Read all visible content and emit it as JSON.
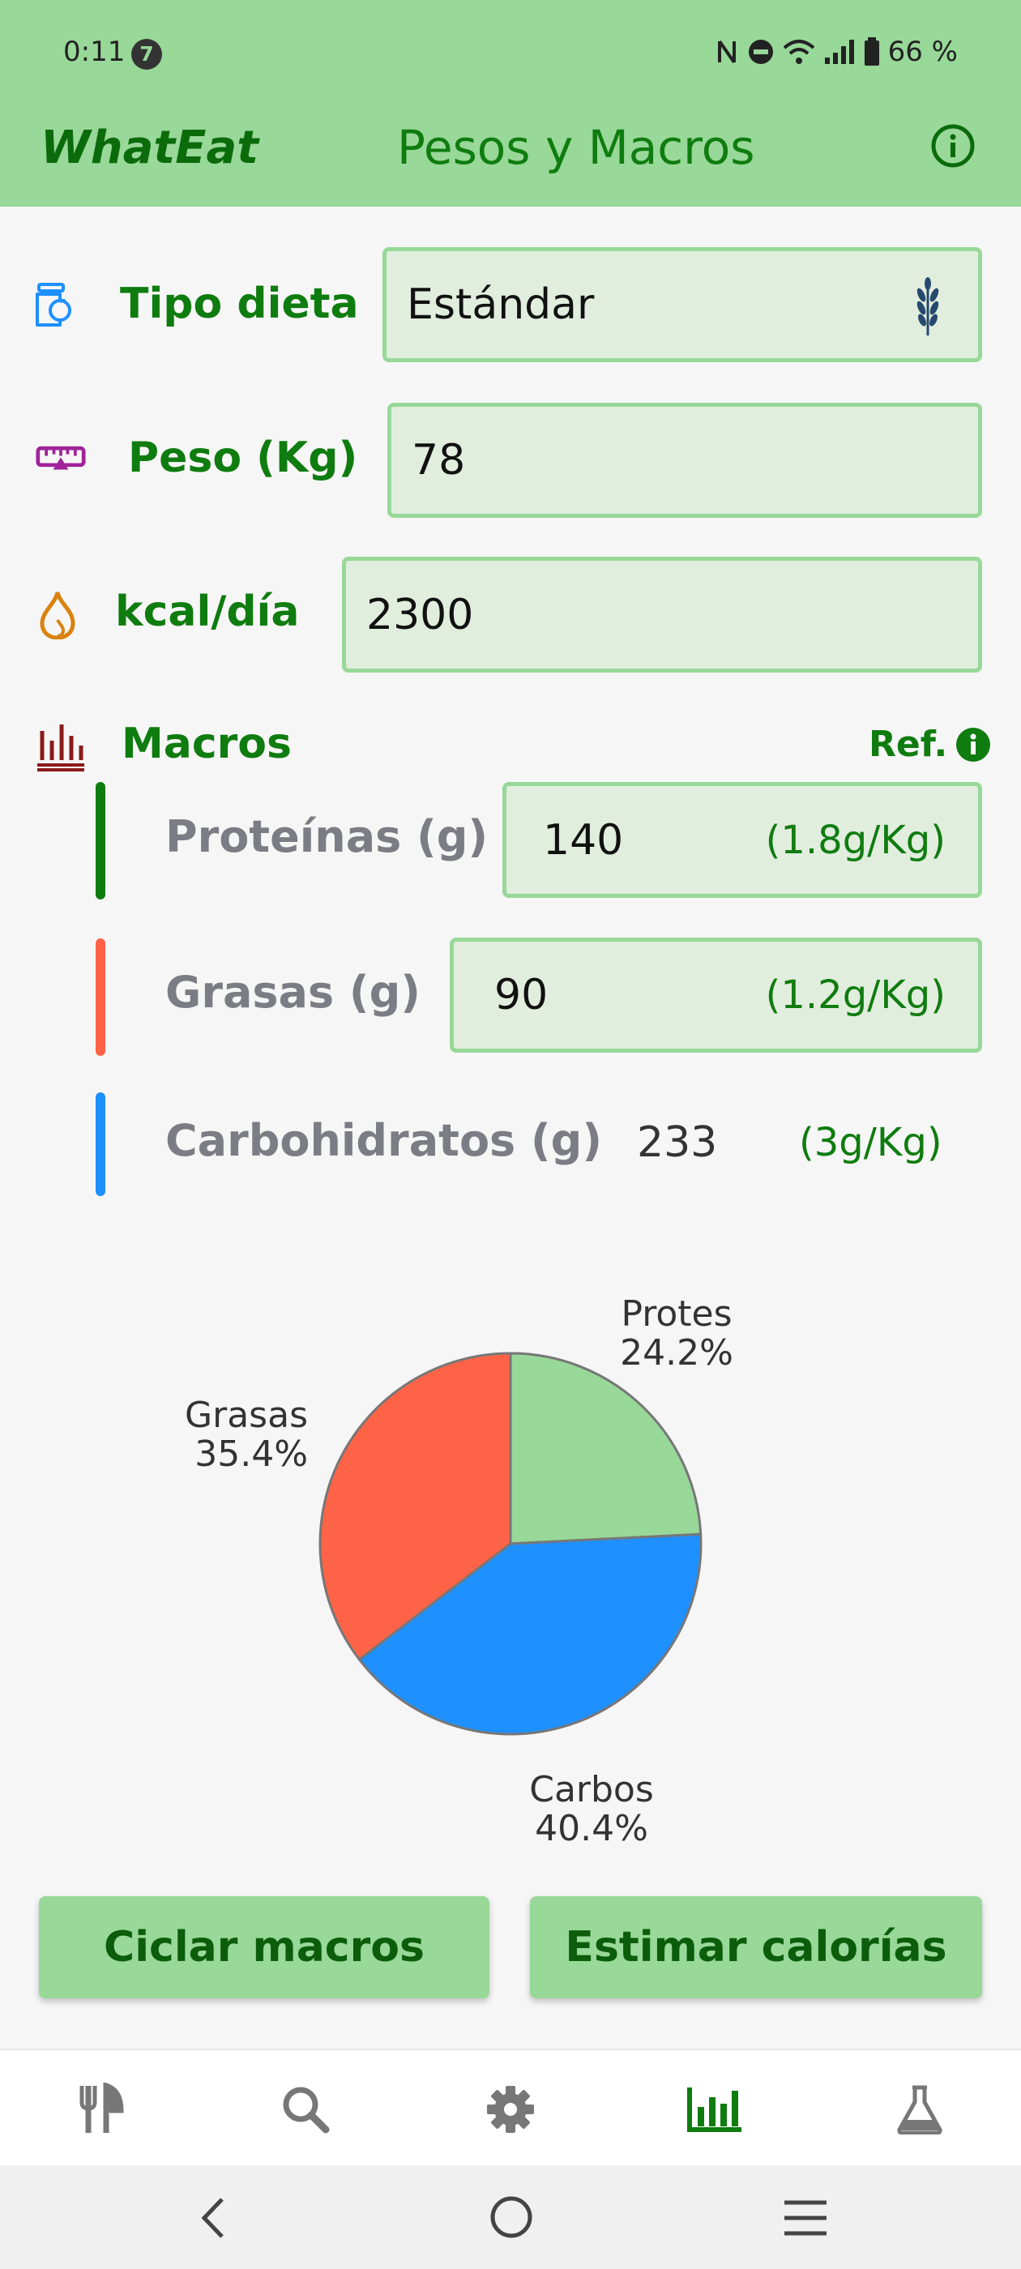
{
  "status_bar": {
    "time": "0:11",
    "notif_count": "7",
    "battery": "66 %"
  },
  "app_bar": {
    "brand": "WhatEat",
    "title": "Pesos y Macros",
    "info_icon": "info-icon"
  },
  "diet": {
    "label": "Tipo dieta",
    "value": "Estándar",
    "icon": "diet-scale-icon",
    "trailing_icon": "wheat-icon"
  },
  "weight": {
    "label": "Peso (Kg)",
    "value": "78",
    "icon": "scale-icon"
  },
  "kcal": {
    "label": "kcal/día",
    "value": "2300",
    "icon": "flame-icon"
  },
  "macros": {
    "label": "Macros",
    "ref_label": "Ref.",
    "items": [
      {
        "label": "Proteínas (g)",
        "value": "140",
        "ratio": "(1.8g/Kg)",
        "color": "#0f7c0f"
      },
      {
        "label": "Grasas (g)",
        "value": "90",
        "ratio": "(1.2g/Kg)",
        "color": "#ff6347"
      },
      {
        "label": "Carbohidratos (g)",
        "value": "233",
        "ratio": "(3g/Kg)",
        "color": "#1e90ff"
      }
    ]
  },
  "chart_data": {
    "type": "pie",
    "slices": [
      {
        "label": "Protes",
        "percent_label": "24.2%",
        "value": 24.2,
        "color": "#98d898"
      },
      {
        "label": "Carbos",
        "percent_label": "40.4%",
        "value": 40.4,
        "color": "#1e90ff"
      },
      {
        "label": "Grasas",
        "percent_label": "35.4%",
        "value": 35.4,
        "color": "#ff6347"
      }
    ]
  },
  "buttons": {
    "cycle": "Ciclar macros",
    "estimate": "Estimar calorías"
  },
  "bottom_nav": {
    "items": [
      {
        "name": "nav-meals",
        "icon": "fork-knife-icon"
      },
      {
        "name": "nav-search",
        "icon": "search-icon"
      },
      {
        "name": "nav-settings",
        "icon": "gear-icon"
      },
      {
        "name": "nav-stats",
        "icon": "bar-chart-icon",
        "active": true
      },
      {
        "name": "nav-lab",
        "icon": "flask-icon"
      }
    ]
  },
  "colors": {
    "accent": "#98d898",
    "brand_green": "#0f7c0f",
    "field_bg": "#e1eede"
  }
}
